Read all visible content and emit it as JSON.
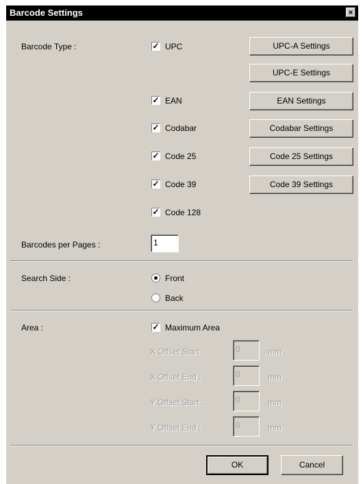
{
  "window": {
    "title": "Barcode Settings",
    "close": "×"
  },
  "barcode_type": {
    "label": "Barcode Type :",
    "options": [
      {
        "label": "UPC",
        "checked": true
      },
      {
        "label": "EAN",
        "checked": true
      },
      {
        "label": "Codabar",
        "checked": true
      },
      {
        "label": "Code 25",
        "checked": true
      },
      {
        "label": "Code 39",
        "checked": true
      },
      {
        "label": "Code 128",
        "checked": true
      }
    ],
    "buttons": {
      "upca": "UPC-A Settings",
      "upce": "UPC-E Settings",
      "ean": "EAN Settings",
      "codabar": "Codabar Settings",
      "code25": "Code 25 Settings",
      "code39": "Code 39 Settings"
    }
  },
  "per_page": {
    "label": "Barcodes per Pages :",
    "value": "1"
  },
  "search_side": {
    "label": "Search Side :",
    "options": [
      {
        "label": "Front",
        "selected": true
      },
      {
        "label": "Back",
        "selected": false
      }
    ]
  },
  "area": {
    "label": "Area :",
    "max_area": {
      "label": "Maximum Area",
      "checked": true
    },
    "offsets": [
      {
        "label": "X Offset Start :",
        "value": "0",
        "unit": "mm"
      },
      {
        "label": "X Offset End :",
        "value": "0",
        "unit": "mm"
      },
      {
        "label": "Y Offset Start :",
        "value": "0",
        "unit": "mm"
      },
      {
        "label": "Y Offset End :",
        "value": "0",
        "unit": "mm"
      }
    ]
  },
  "footer": {
    "ok": "OK",
    "cancel": "Cancel"
  },
  "check_mark": "✓"
}
